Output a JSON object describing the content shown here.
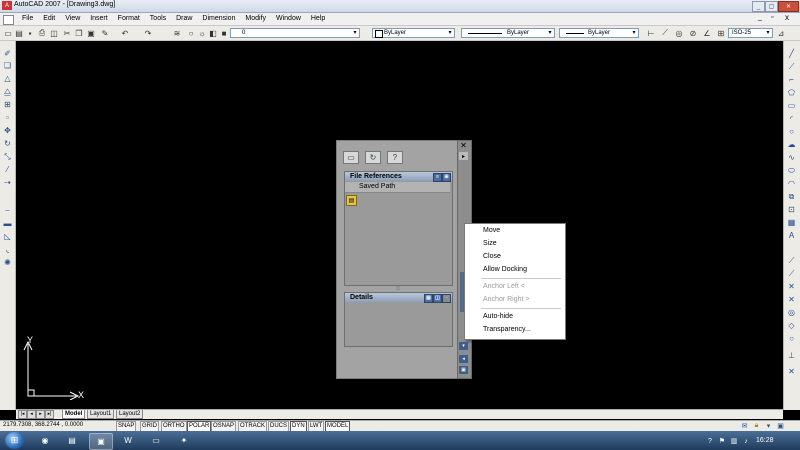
{
  "window": {
    "title": "AutoCAD 2007 - [Drawing3.dwg]",
    "controls": [
      "_",
      "▢",
      "✕"
    ]
  },
  "menubar": {
    "items": [
      "File",
      "Edit",
      "View",
      "Insert",
      "Format",
      "Tools",
      "Draw",
      "Dimension",
      "Modify",
      "Window",
      "Help"
    ],
    "doc_controls": [
      "_",
      "▫",
      "x"
    ]
  },
  "toolbar": {
    "layer_combo_value": "0",
    "color_combo_value": "ByLayer",
    "linetype_combo_value": "ByLayer",
    "lineweight_combo_value": "ByLayer",
    "dimstyle_combo_value": "ISO-25"
  },
  "xref_palette": {
    "file_references_title": "File References",
    "column_saved_path": "Saved Path",
    "details_title": "Details",
    "close_glyph": "✕"
  },
  "context_menu": {
    "items": [
      {
        "label": "Move",
        "enabled": true
      },
      {
        "label": "Size",
        "enabled": true
      },
      {
        "label": "Close",
        "enabled": true
      },
      {
        "label": "Allow Docking",
        "enabled": true
      },
      {
        "label": "Anchor Left  <",
        "enabled": false
      },
      {
        "label": "Anchor Right  >",
        "enabled": false
      },
      {
        "label": "Auto-hide",
        "enabled": true
      },
      {
        "label": "Transparency...",
        "enabled": true
      }
    ]
  },
  "ucs": {
    "x_label": "X",
    "y_label": "Y"
  },
  "layout_tabs": [
    "Model",
    "Layout1",
    "Layout2"
  ],
  "statusbar": {
    "coordinates": "2179.7308, 368.2744 , 0.0000",
    "buttons": [
      {
        "label": "SNAP",
        "on": false
      },
      {
        "label": "GRID",
        "on": false
      },
      {
        "label": "ORTHO",
        "on": false
      },
      {
        "label": "POLAR",
        "on": true
      },
      {
        "label": "OSNAP",
        "on": false
      },
      {
        "label": "OTRACK",
        "on": false
      },
      {
        "label": "DUCS",
        "on": false
      },
      {
        "label": "DYN",
        "on": true
      },
      {
        "label": "LWT",
        "on": false
      },
      {
        "label": "MODEL",
        "on": true
      }
    ]
  },
  "taskbar": {
    "clock": "16:28"
  },
  "colors": {
    "canvas": "#000000",
    "palette_grey": "#a3a3a3",
    "taskbar_blue": "#1f3b5c"
  }
}
